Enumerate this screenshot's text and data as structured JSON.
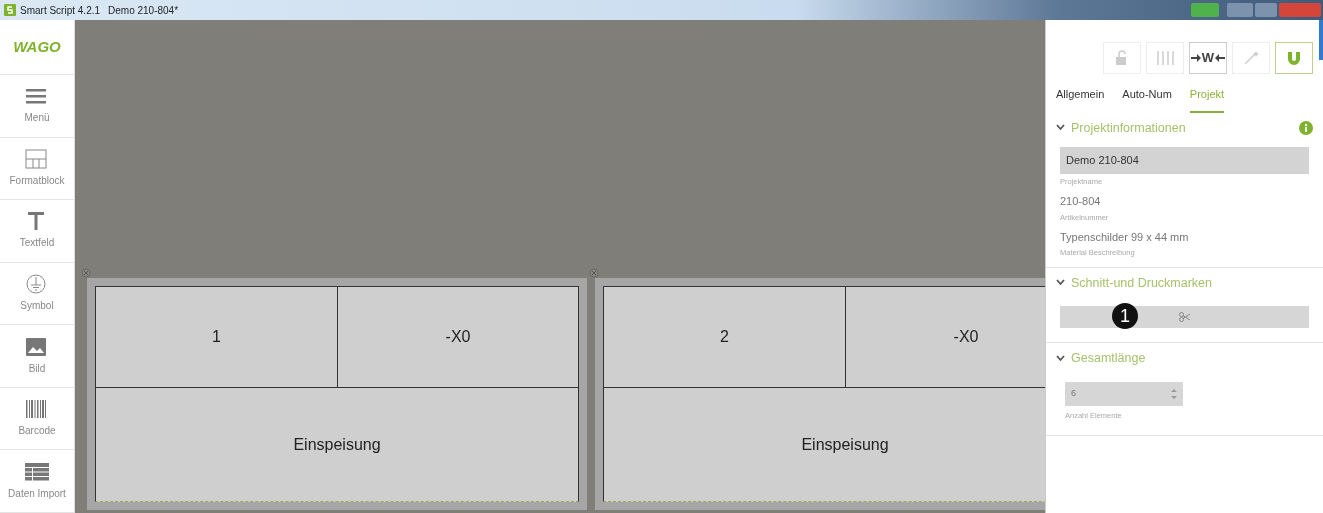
{
  "window": {
    "app": "Smart Script 4.2.1",
    "document": "Demo 210-804*"
  },
  "sidebar": {
    "logo": "WAGO",
    "items": [
      {
        "label": "Menü",
        "kind": "menu"
      },
      {
        "label": "Formatblock",
        "kind": "format"
      },
      {
        "label": "Textfeld",
        "kind": "text"
      },
      {
        "label": "Symbol",
        "kind": "symbol"
      },
      {
        "label": "Bild",
        "kind": "image"
      },
      {
        "label": "Barcode",
        "kind": "barcode"
      },
      {
        "label": "Daten Import",
        "kind": "table"
      }
    ]
  },
  "labels": [
    {
      "cells": [
        "1",
        "-X0"
      ],
      "bottom": "Einspeisung"
    },
    {
      "cells": [
        "2",
        "-X0"
      ],
      "bottom": "Einspeisung"
    }
  ],
  "toolbar": [
    {
      "kind": "lock",
      "selected": false
    },
    {
      "kind": "columns",
      "selected": false
    },
    {
      "kind": "width",
      "text": "W",
      "selected": true
    },
    {
      "kind": "wand",
      "selected": false
    },
    {
      "kind": "magnet",
      "selected": true
    }
  ],
  "tabs": [
    {
      "label": "Allgemein",
      "selected": false
    },
    {
      "label": "Auto-Num",
      "selected": false
    },
    {
      "label": "Projekt",
      "selected": true
    }
  ],
  "sections": [
    {
      "title": "Projektinformationen",
      "expanded": true,
      "kind": "fields",
      "fields": [
        {
          "value": "Demo 210-804",
          "caption": "Projektname",
          "kind": "filled"
        },
        {
          "value": "210-804",
          "caption": "Artikelnummer",
          "kind": "plain"
        },
        {
          "value": "Typenschilder  99 x 44 mm",
          "caption": "Material Beschreibung",
          "kind": "plain"
        }
      ]
    },
    {
      "title": "Schnitt-und Druckmarken",
      "expanded": true,
      "kind": "button",
      "callout": "1"
    },
    {
      "title": "Gesamtlänge",
      "expanded": true,
      "kind": "spinner",
      "value": "6",
      "caption": "Anzahl Elemente"
    }
  ]
}
